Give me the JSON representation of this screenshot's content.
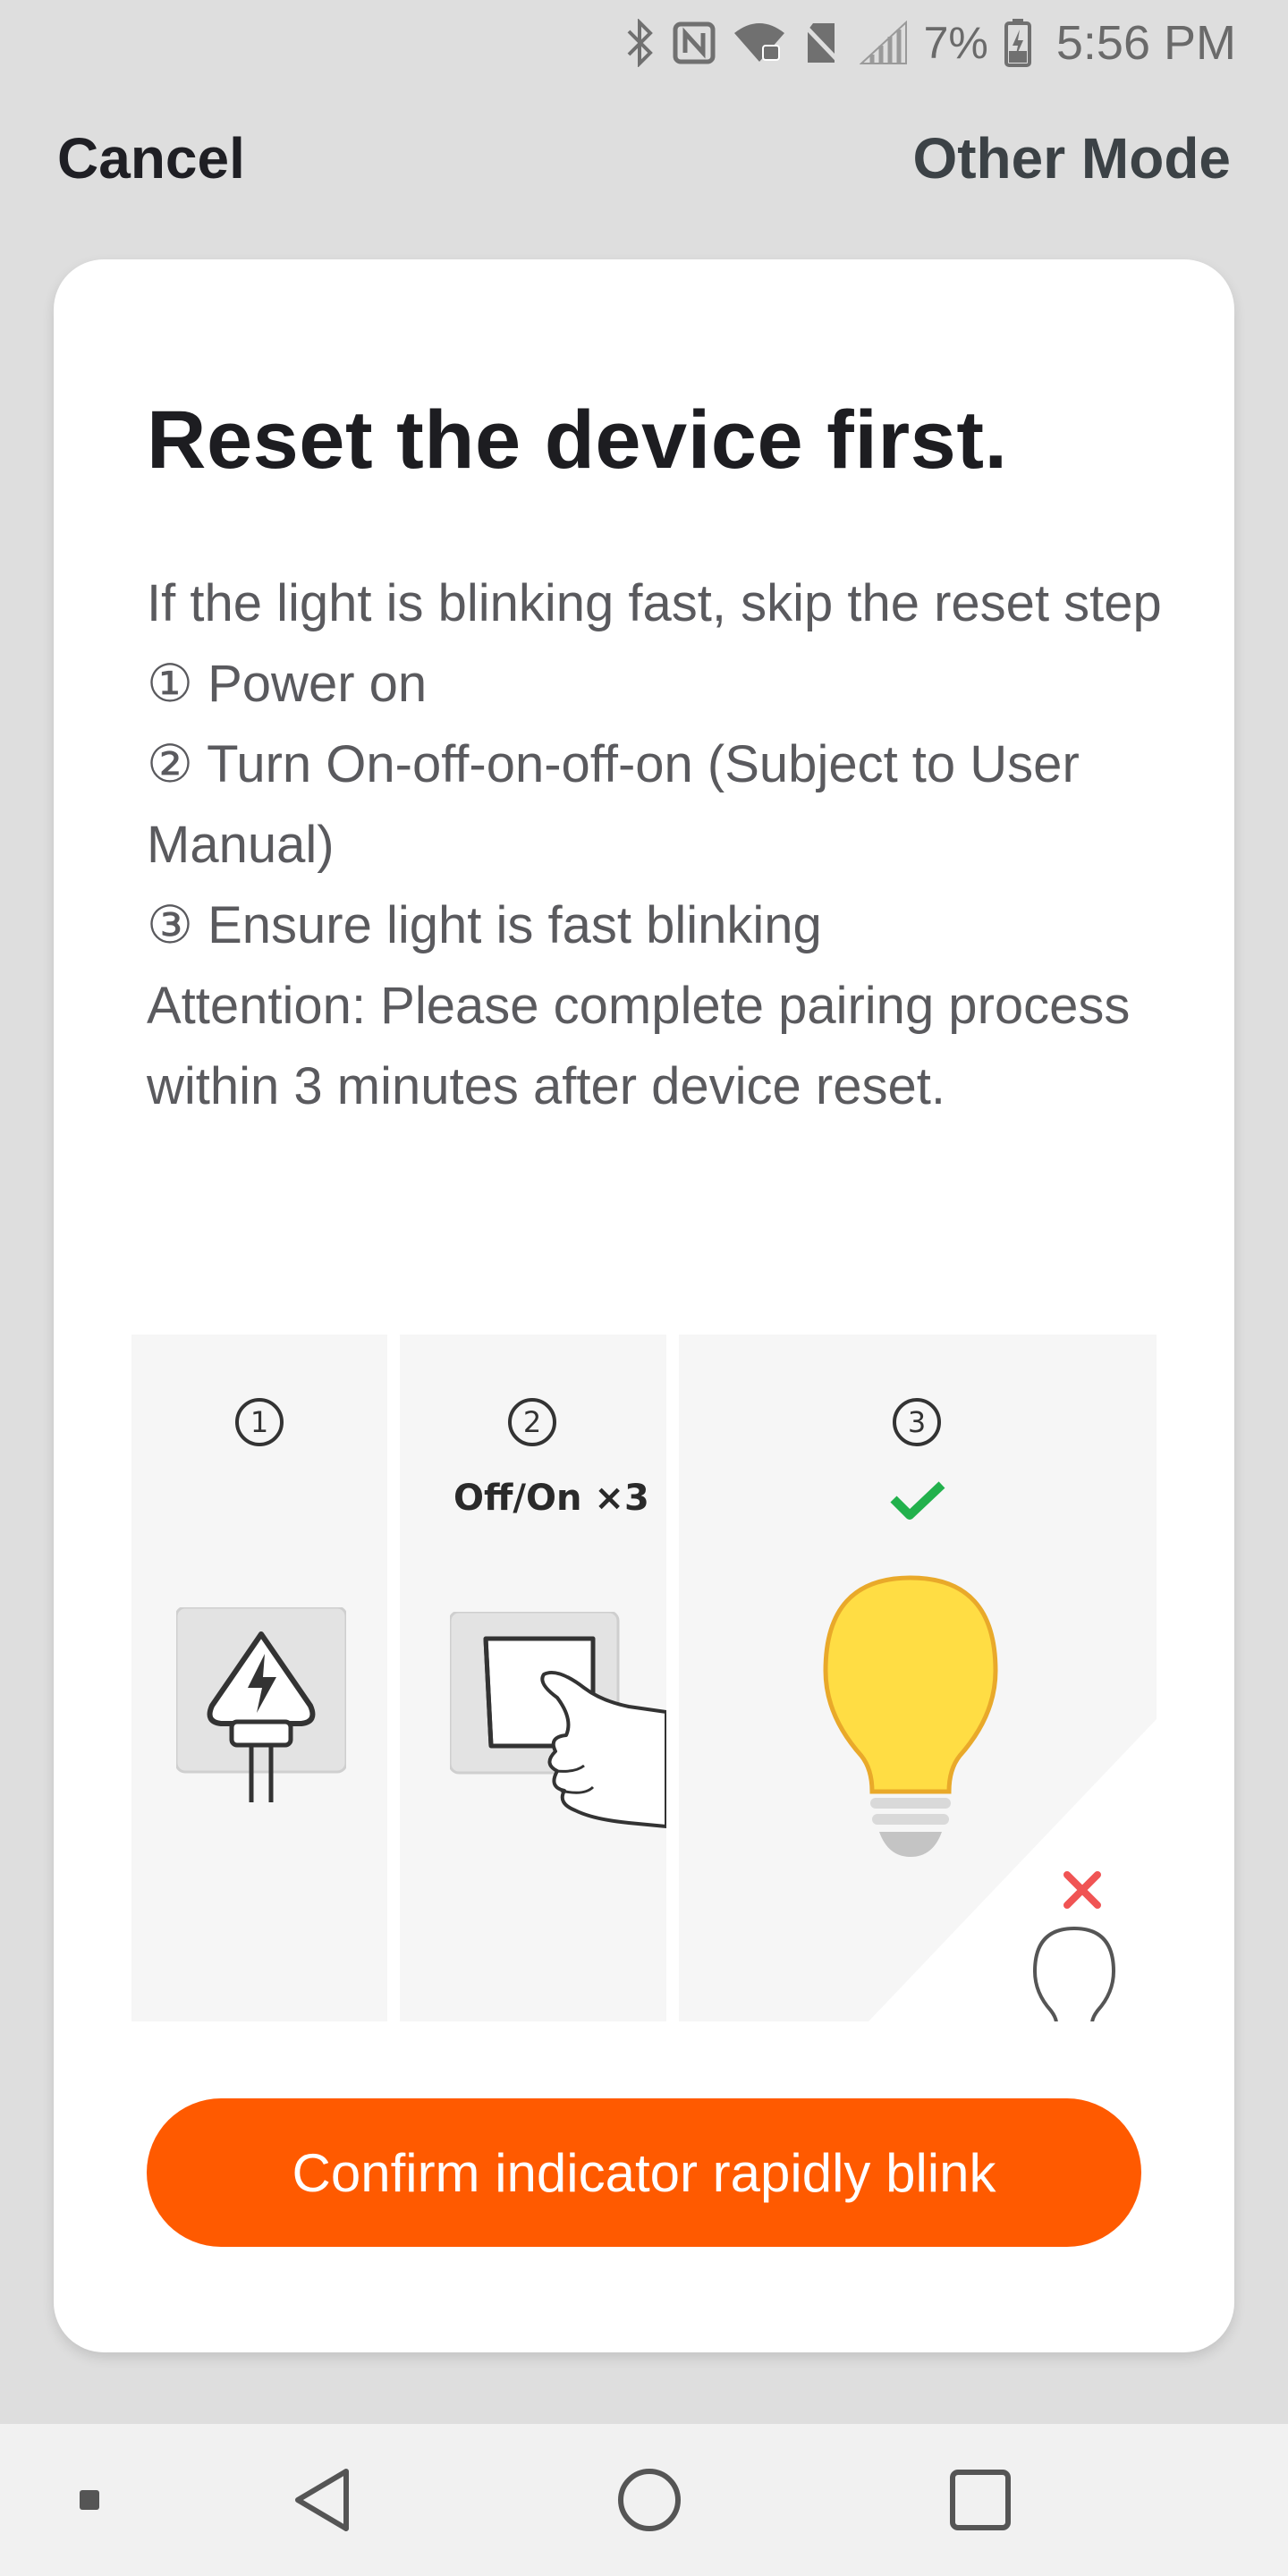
{
  "status_bar": {
    "battery_percent": "7%",
    "time": "5:56 PM",
    "icons": [
      "bluetooth-icon",
      "nfc-icon",
      "wifi-icon",
      "no-sim-icon",
      "signal-icon",
      "battery-charging-icon"
    ]
  },
  "top_nav": {
    "cancel_label": "Cancel",
    "other_mode_label": "Other Mode"
  },
  "card": {
    "title": "Reset the device first.",
    "instructions": [
      "If the light is blinking fast, skip the reset step",
      "① Power on",
      "② Turn On-off-on-off-on (Subject to User Manual)",
      "③ Ensure light is fast blinking",
      "Attention: Please complete pairing process within 3 minutes after device reset."
    ]
  },
  "illustration": {
    "steps": [
      {
        "number": "1",
        "icon": "power-plug-icon"
      },
      {
        "number": "2",
        "label": "Off/On ×3",
        "icon": "wall-switch-press-icon"
      },
      {
        "number": "3",
        "icons": [
          "check-icon",
          "lit-bulb-icon",
          "cross-icon",
          "unlit-bulb-icon"
        ]
      }
    ],
    "colors": {
      "bulb_fill": "#ffdd44",
      "check": "#22b14c",
      "cross": "#f05454"
    }
  },
  "confirm_button": {
    "label": "Confirm indicator rapidly blink",
    "color": "#ff5a00"
  },
  "nav_bar": {
    "buttons": [
      "recents-dot-icon",
      "back-icon",
      "home-icon",
      "overview-icon"
    ]
  }
}
